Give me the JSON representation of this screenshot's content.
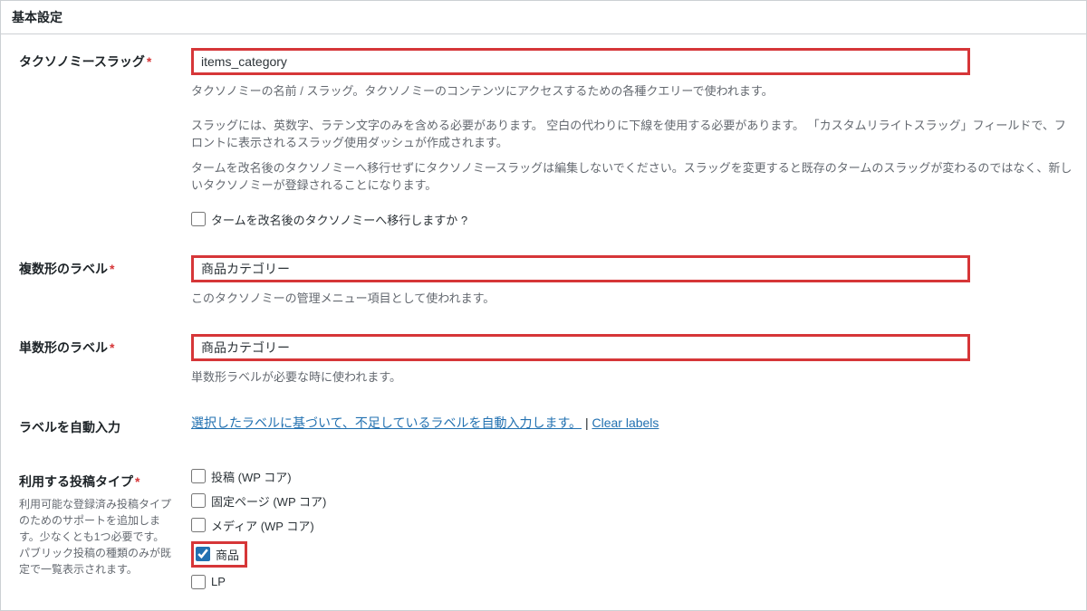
{
  "section_title": "基本設定",
  "fields": {
    "slug": {
      "label": "タクソノミースラッグ",
      "value": "items_category",
      "desc1": "タクソノミーの名前 / スラッグ。タクソノミーのコンテンツにアクセスするための各種クエリーで使われます。",
      "desc2": "スラッグには、英数字、ラテン文字のみを含める必要があります。 空白の代わりに下線を使用する必要があります。 「カスタムリライトスラッグ」フィールドで、フロントに表示されるスラッグ使用ダッシュが作成されます。",
      "desc3": "タームを改名後のタクソノミーへ移行せずにタクソノミースラッグは編集しないでください。スラッグを変更すると既存のタームのスラッグが変わるのではなく、新しいタクソノミーが登録されることになります。",
      "migrate_label": "タームを改名後のタクソノミーへ移行しますか ?"
    },
    "plural": {
      "label": "複数形のラベル",
      "value": "商品カテゴリー",
      "desc": "このタクソノミーの管理メニュー項目として使われます。"
    },
    "singular": {
      "label": "単数形のラベル",
      "value": "商品カテゴリー",
      "desc": "単数形ラベルが必要な時に使われます。"
    },
    "auto_labels": {
      "label": "ラベルを自動入力",
      "link_text": "選択したラベルに基づいて、不足しているラベルを自動入力します。",
      "separator": " | ",
      "clear": "Clear labels"
    },
    "post_types": {
      "label": "利用する投稿タイプ",
      "sub": "利用可能な登録済み投稿タイプのためのサポートを追加します。少なくとも1つ必要です。パブリック投稿の種類のみが既定で一覧表示されます。",
      "options": {
        "post": "投稿 (WP コア)",
        "page": "固定ページ (WP コア)",
        "media": "メディア (WP コア)",
        "product": "商品",
        "lp": "LP"
      }
    }
  }
}
